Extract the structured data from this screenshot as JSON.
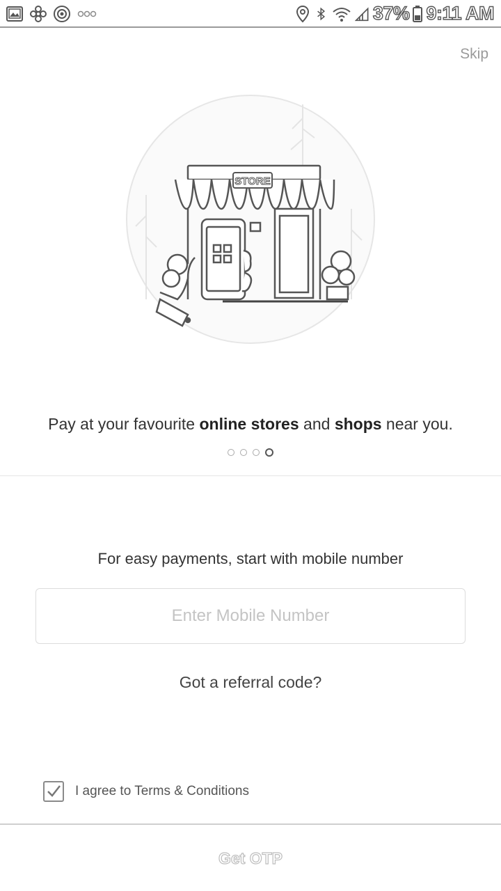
{
  "status_bar": {
    "left_icons": [
      "image-icon",
      "pinwheel-icon",
      "target-icon",
      "more-dots-icon"
    ],
    "right_icons": [
      "location-icon",
      "bluetooth-icon",
      "wifi-icon",
      "signal-icon",
      "battery-icon"
    ],
    "battery": "37%",
    "time": "9:11 AM"
  },
  "skip_label": "Skip",
  "illustration": {
    "store_sign": "STORE"
  },
  "caption": {
    "part1": "Pay at your favourite ",
    "bold1": "online stores",
    "part2": " and ",
    "bold2": "shops",
    "part3": " near you."
  },
  "pager": {
    "count": 4,
    "active_index": 3
  },
  "login": {
    "prompt": "For easy payments, start with mobile number",
    "mobile_placeholder": "Enter Mobile Number",
    "mobile_value": "",
    "referral_label": "Got a referral code?"
  },
  "terms": {
    "checked": true,
    "prefix": "I agree to ",
    "link": "Terms & Conditions"
  },
  "otp_button_label": "Get OTP",
  "colors": {
    "text": "#333333",
    "muted": "#9a9a9a",
    "border": "#dcdcdc"
  }
}
